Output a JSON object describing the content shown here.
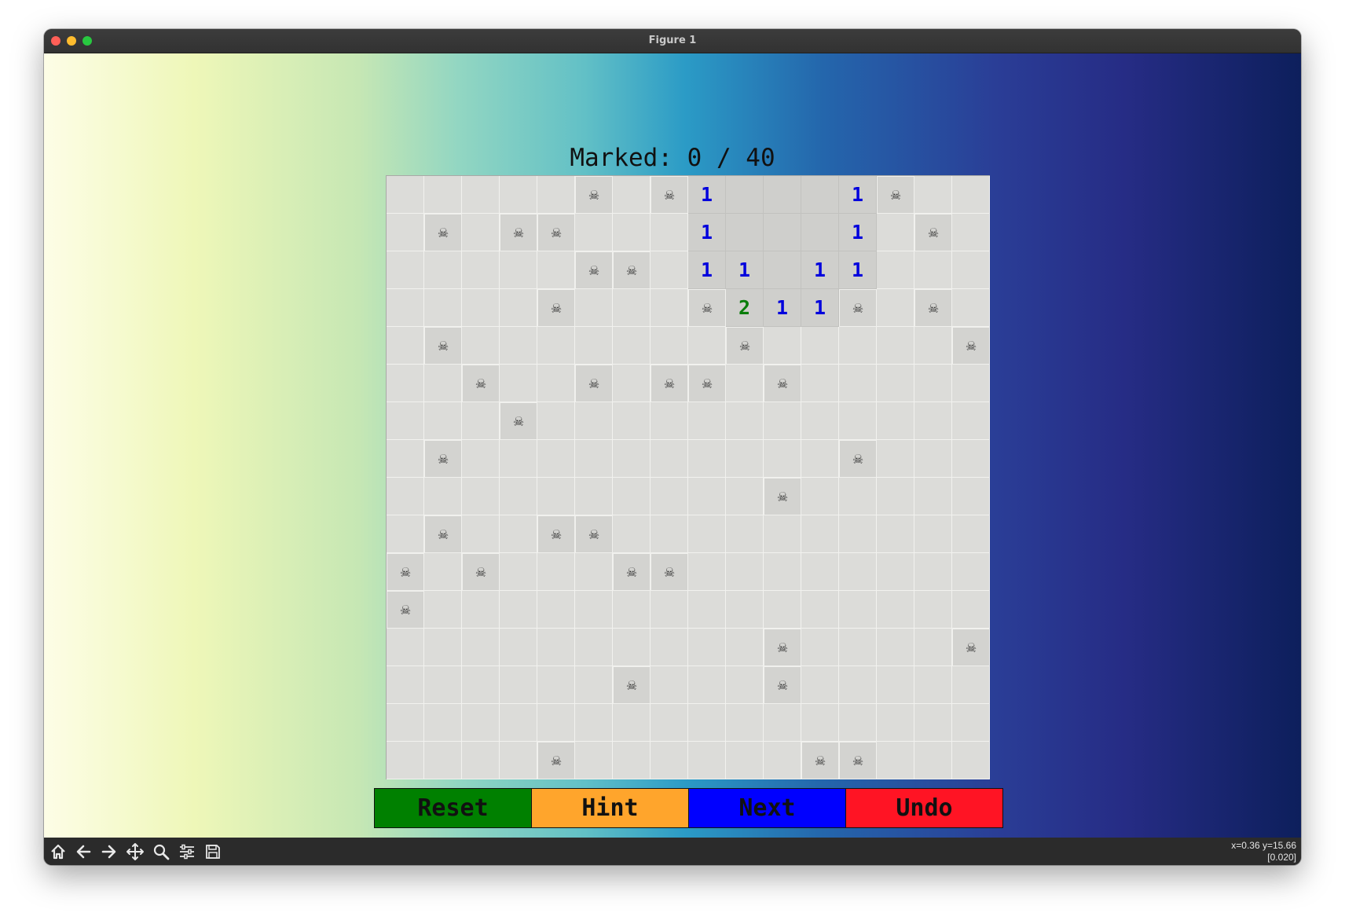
{
  "window": {
    "title": "Figure 1"
  },
  "status": {
    "text": "Marked: 0 / 40"
  },
  "board": {
    "rows": 16,
    "cols": 16,
    "cells": [
      [
        "",
        "",
        "",
        "",
        "",
        "M",
        "",
        "M",
        "1",
        "O",
        "O",
        "O",
        "1",
        "M",
        "",
        ""
      ],
      [
        "",
        "M",
        "",
        "M",
        "M",
        "",
        "",
        "",
        "1",
        "O",
        "O",
        "O",
        "1",
        "",
        "M",
        ""
      ],
      [
        "",
        "",
        "",
        "",
        "",
        "M",
        "M",
        "",
        "1",
        "1",
        "O",
        "1",
        "1",
        "",
        "",
        ""
      ],
      [
        "",
        "",
        "",
        "",
        "M",
        "",
        "",
        "",
        "M",
        "2",
        "1",
        "1",
        "M",
        "",
        "M",
        ""
      ],
      [
        "",
        "M",
        "",
        "",
        "",
        "",
        "",
        "",
        "",
        "M",
        "",
        "",
        "",
        "",
        "",
        "M"
      ],
      [
        "",
        "",
        "M",
        "",
        "",
        "M",
        "",
        "M",
        "M",
        "",
        "M",
        "",
        "",
        "",
        "",
        ""
      ],
      [
        "",
        "",
        "",
        "M",
        "",
        "",
        "",
        "",
        "",
        "",
        "",
        "",
        "",
        "",
        "",
        ""
      ],
      [
        "",
        "M",
        "",
        "",
        "",
        "",
        "",
        "",
        "",
        "",
        "",
        "",
        "M",
        "",
        "",
        ""
      ],
      [
        "",
        "",
        "",
        "",
        "",
        "",
        "",
        "",
        "",
        "",
        "M",
        "",
        "",
        "",
        "",
        ""
      ],
      [
        "",
        "M",
        "",
        "",
        "M",
        "M",
        "",
        "",
        "",
        "",
        "",
        "",
        "",
        "",
        "",
        ""
      ],
      [
        "M",
        "",
        "M",
        "",
        "",
        "",
        "M",
        "M",
        "",
        "",
        "",
        "",
        "",
        "",
        "",
        ""
      ],
      [
        "M",
        "",
        "",
        "",
        "",
        "",
        "",
        "",
        "",
        "",
        "",
        "",
        "",
        "",
        "",
        ""
      ],
      [
        "",
        "",
        "",
        "",
        "",
        "",
        "",
        "",
        "",
        "",
        "M",
        "",
        "",
        "",
        "",
        "M"
      ],
      [
        "",
        "",
        "",
        "",
        "",
        "",
        "M",
        "",
        "",
        "",
        "M",
        "",
        "",
        "",
        "",
        ""
      ],
      [
        "",
        "",
        "",
        "",
        "",
        "",
        "",
        "",
        "",
        "",
        "",
        "",
        "",
        "",
        "",
        ""
      ],
      [
        "",
        "",
        "",
        "",
        "M",
        "",
        "",
        "",
        "",
        "",
        "",
        "M",
        "M",
        "",
        "",
        ""
      ]
    ],
    "mine_glyph": "☠",
    "number_colors": {
      "1": "#0000dd",
      "2": "#0a7d0a"
    }
  },
  "buttons": [
    {
      "label": "Reset",
      "color": "#008000",
      "name": "reset-button"
    },
    {
      "label": "Hint",
      "color": "#ffa52c",
      "name": "hint-button"
    },
    {
      "label": "Next",
      "color": "#0000ff",
      "name": "next-button"
    },
    {
      "label": "Undo",
      "color": "#ff1424",
      "name": "undo-button"
    }
  ],
  "toolbar": {
    "tools": [
      "home-icon",
      "back-icon",
      "forward-icon",
      "pan-icon",
      "zoom-icon",
      "configure-icon",
      "save-icon"
    ],
    "coords_line1": "x=0.36 y=15.66",
    "coords_line2": "[0.020]"
  }
}
